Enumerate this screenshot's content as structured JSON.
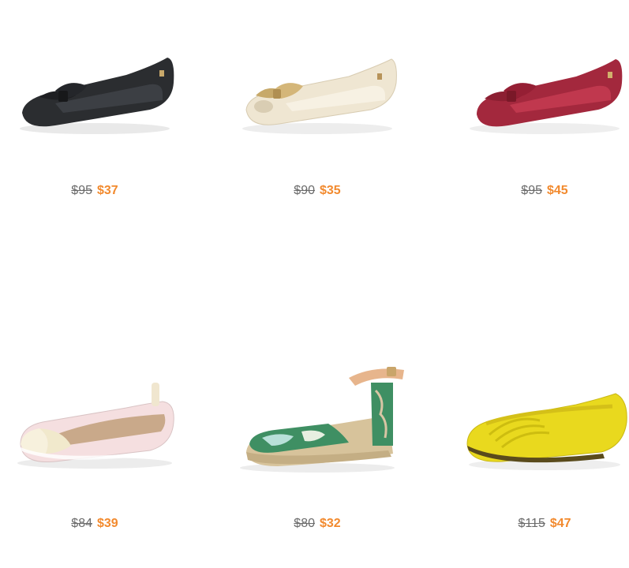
{
  "products": [
    {
      "name": "Black bow flat",
      "old_price": "$95",
      "new_price": "$37",
      "color": "#2b2d30"
    },
    {
      "name": "Cream bow peep-toe flat",
      "old_price": "$90",
      "new_price": "$35",
      "color": "#efe6d2"
    },
    {
      "name": "Burgundy bow flat",
      "old_price": "$95",
      "new_price": "$45",
      "color": "#a3283d"
    },
    {
      "name": "Pink ballet flat",
      "old_price": "$84",
      "new_price": "$39",
      "color": "#f5dfe0"
    },
    {
      "name": "Floral ankle-strap espadrille",
      "old_price": "$80",
      "new_price": "$32",
      "color": "#3f8f63"
    },
    {
      "name": "Yellow pleated flat",
      "old_price": "$115",
      "new_price": "$47",
      "color": "#e9d91e"
    }
  ],
  "colors": {
    "old_price": "#6b6b6b",
    "sale_price": "#f28a2e"
  }
}
